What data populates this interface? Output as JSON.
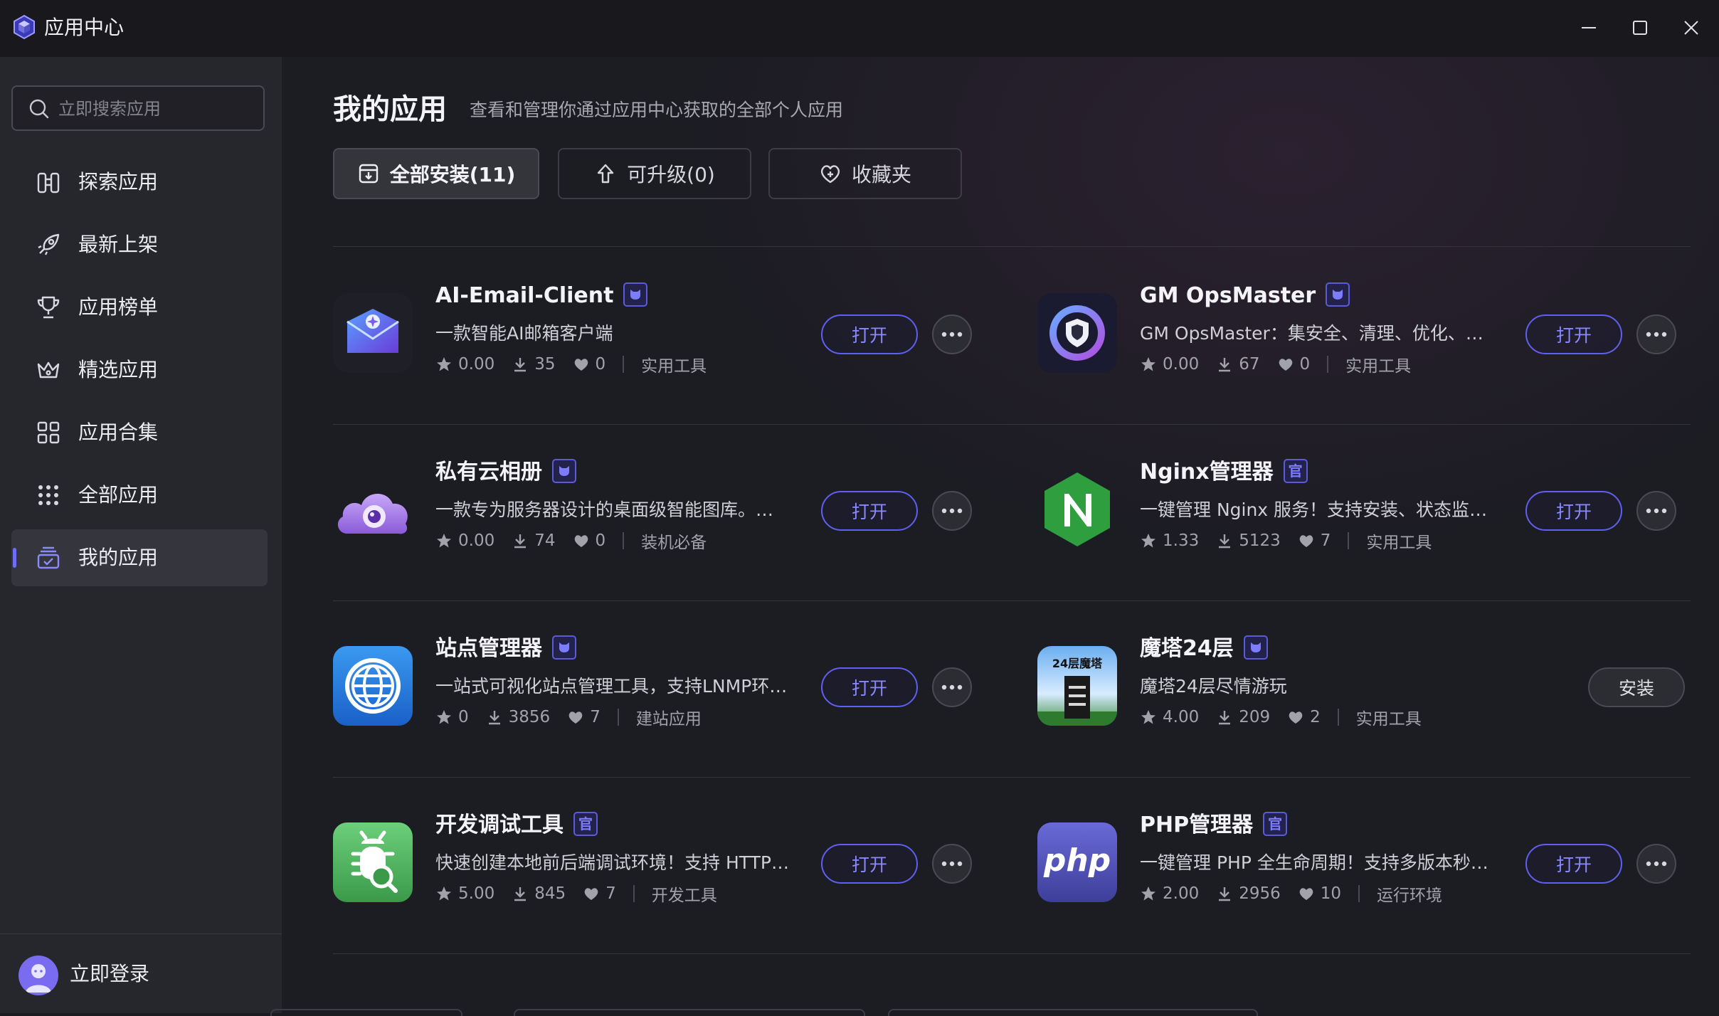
{
  "window": {
    "title": "应用中心"
  },
  "sidebar": {
    "search_placeholder": "立即搜索应用",
    "items": [
      {
        "label": "探索应用",
        "icon": "binoculars-icon"
      },
      {
        "label": "最新上架",
        "icon": "rocket-icon"
      },
      {
        "label": "应用榜单",
        "icon": "trophy-icon"
      },
      {
        "label": "精选应用",
        "icon": "crown-icon"
      },
      {
        "label": "应用合集",
        "icon": "grid-icon"
      },
      {
        "label": "全部应用",
        "icon": "dots-grid-icon"
      },
      {
        "label": "我的应用",
        "icon": "my-apps-icon",
        "active": true
      }
    ],
    "login_label": "立即登录"
  },
  "main": {
    "title": "我的应用",
    "subtitle": "查看和管理你通过应用中心获取的全部个人应用",
    "tabs": [
      {
        "label": "全部安装(11)",
        "icon": "download-box-icon",
        "active": true
      },
      {
        "label": "可升级(0)",
        "icon": "arrow-up-icon"
      },
      {
        "label": "收藏夹",
        "icon": "heart-plus-icon"
      }
    ]
  },
  "apps": [
    {
      "name": "AI-Email-Client",
      "badge": "github",
      "desc": "一款智能AI邮箱客户端",
      "rating": "0.00",
      "downloads": "35",
      "likes": "0",
      "category": "实用工具",
      "action": "打开"
    },
    {
      "name": "GM OpsMaster",
      "badge": "github",
      "desc": "GM OpsMaster：集安全、清理、优化、分析...",
      "rating": "0.00",
      "downloads": "67",
      "likes": "0",
      "category": "实用工具",
      "action": "打开"
    },
    {
      "name": "私有云相册",
      "badge": "github",
      "desc": "一款专为服务器设计的桌面级智能图库。免 N...",
      "rating": "0.00",
      "downloads": "74",
      "likes": "0",
      "category": "装机必备",
      "action": "打开"
    },
    {
      "name": "Nginx管理器",
      "badge": "官",
      "desc": "一键管理 Nginx 服务！支持安装、状态监控...",
      "rating": "1.33",
      "downloads": "5123",
      "likes": "7",
      "category": "实用工具",
      "action": "打开"
    },
    {
      "name": "站点管理器",
      "badge": "github",
      "desc": "一站式可视化站点管理工具，支持LNMP环境...",
      "rating": "0",
      "downloads": "3856",
      "likes": "7",
      "category": "建站应用",
      "action": "打开"
    },
    {
      "name": "魔塔24层",
      "badge": "github",
      "desc": "魔塔24层尽情游玩",
      "rating": "4.00",
      "downloads": "209",
      "likes": "2",
      "category": "实用工具",
      "action": "安装",
      "icon_text": "24层魔塔"
    },
    {
      "name": "开发调试工具",
      "badge": "官",
      "desc": "快速创建本地前后端调试环境！支持 HTTP/S...",
      "rating": "5.00",
      "downloads": "845",
      "likes": "7",
      "category": "开发工具",
      "action": "打开"
    },
    {
      "name": "PHP管理器",
      "badge": "官",
      "desc": "一键管理 PHP 全生命周期！支持多版本秒级...",
      "rating": "2.00",
      "downloads": "2956",
      "likes": "10",
      "category": "运行环境",
      "action": "打开",
      "icon_text": "php"
    }
  ],
  "colors": {
    "accent": "#6d6df8",
    "background": "#1c1c23",
    "sidebar": "#26262d"
  }
}
